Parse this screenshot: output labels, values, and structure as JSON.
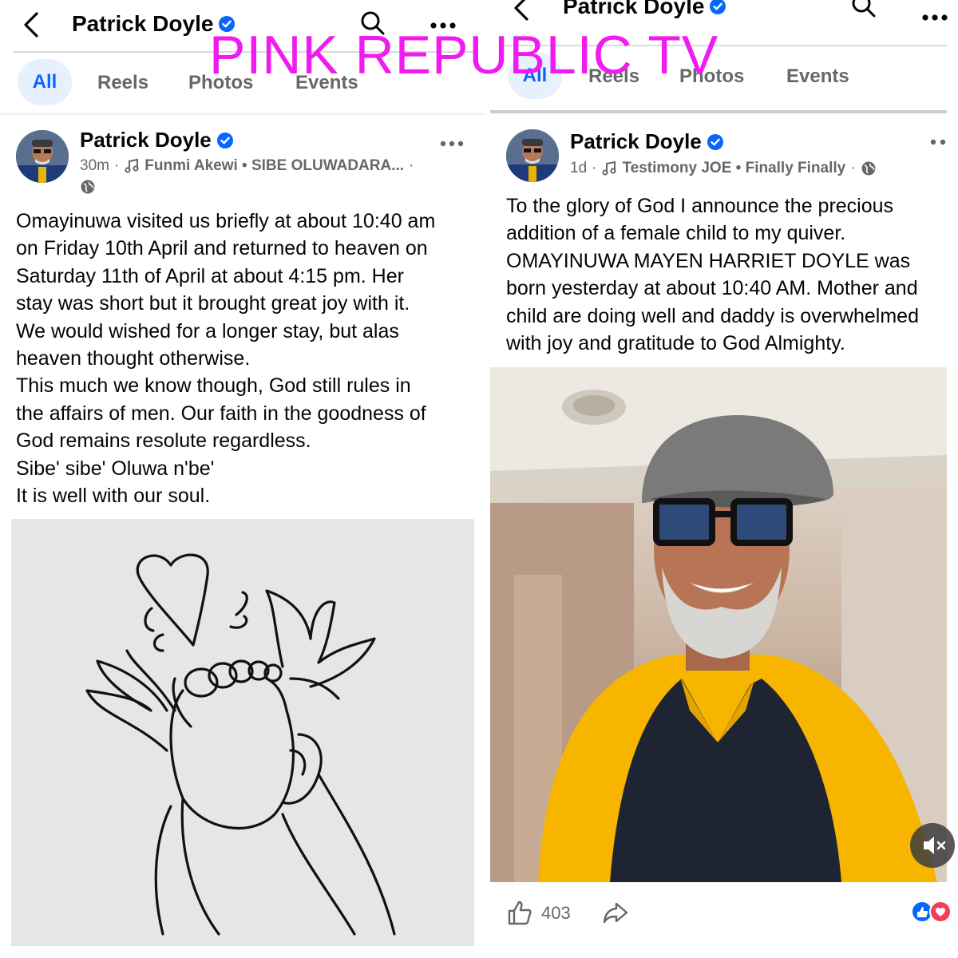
{
  "watermark": "PINK REPUBLIC TV",
  "left": {
    "header": {
      "title": "Patrick Doyle"
    },
    "tabs": [
      "All",
      "Reels",
      "Photos",
      "Events"
    ],
    "post": {
      "author": "Patrick Doyle",
      "time": "30m",
      "music": "Funmi Akewi • SIBE OLUWADARA...",
      "lines": [
        "Omayinuwa visited us briefly at about 10:40 am",
        "on Friday 10th April and returned to heaven on",
        "Saturday 11th of April at about 4:15 pm.  Her",
        "stay was short but it brought great joy with it.",
        "We would wished for a longer stay, but alas",
        "heaven thought otherwise.",
        "This much we know though, God still rules in",
        "the affairs of men. Our faith in the goodness of",
        "God remains resolute regardless.",
        "Sibe' sibe' Oluwa n'be'",
        "It is well with our soul."
      ]
    }
  },
  "right": {
    "header": {
      "title": "Patrick Doyle"
    },
    "tabs": [
      "All",
      "Reels",
      "Photos",
      "Events"
    ],
    "post": {
      "author": "Patrick Doyle",
      "time": "1d",
      "music": "Testimony JOE • Finally Finally",
      "lines": [
        "To the glory of God I announce the precious",
        "addition of a female child to my quiver.",
        "OMAYINUWA MAYEN HARRIET DOYLE was",
        "born yesterday at about 10:40 AM. Mother and",
        "child are doing well and daddy is overwhelmed",
        "with joy and gratitude to God Almighty."
      ],
      "like_count": "403"
    }
  },
  "colors": {
    "accent": "#0866ff",
    "active_tab_bg": "#e7f0fd",
    "secondary_text": "#65676b",
    "watermark": "#f01bf0",
    "shirt": "#f7b500"
  },
  "icons": [
    "back-arrow-icon",
    "verified-icon",
    "search-icon",
    "more-icon",
    "music-note-icon",
    "globe-icon",
    "like-icon",
    "share-icon",
    "mute-icon",
    "reactions-icon"
  ]
}
